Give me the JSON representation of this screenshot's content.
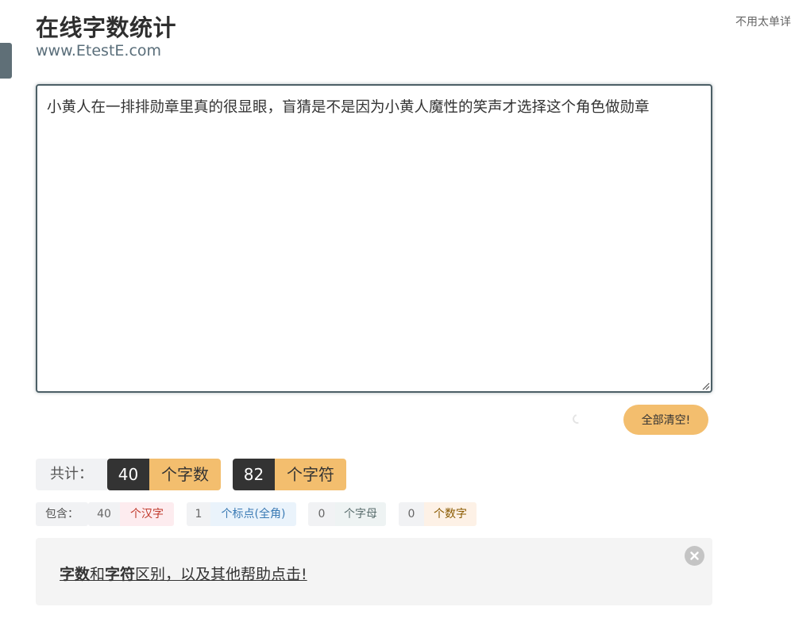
{
  "header": {
    "title": "在线字数统计",
    "url": "www.EtestE.com",
    "right_note": "不用太单详"
  },
  "editor": {
    "text": "小黄人在一排排勋章里真的很显眼，盲猜是不是因为小黄人魔性的笑声才选择这个角色做勋章"
  },
  "actions": {
    "clear_label": "全部清空!"
  },
  "totals": {
    "label": "共计：",
    "words": {
      "value": "40",
      "unit": "个字数"
    },
    "chars": {
      "value": "82",
      "unit": "个字符"
    }
  },
  "breakdown": {
    "label": "包含：",
    "items": [
      {
        "value": "40",
        "unit": "个汉字",
        "color": "#c0392b",
        "bg": "#fdecef"
      },
      {
        "value": "1",
        "unit": "个标点(全角)",
        "color": "#3a7ab4",
        "bg": "#eaf3fb"
      },
      {
        "value": "0",
        "unit": "个字母",
        "color": "#5a6e6e",
        "bg": "#eef3f3"
      },
      {
        "value": "0",
        "unit": "个数字",
        "color": "#8a5a00",
        "bg": "#fdf1e6"
      }
    ]
  },
  "help": {
    "part1": "字数",
    "part2": "和",
    "part3": "字符",
    "part4": "区别，以及其他帮助点击!"
  },
  "colors": {
    "accent": "#f3be6e",
    "dark": "#333333",
    "editor_border": "#4c5f66"
  }
}
